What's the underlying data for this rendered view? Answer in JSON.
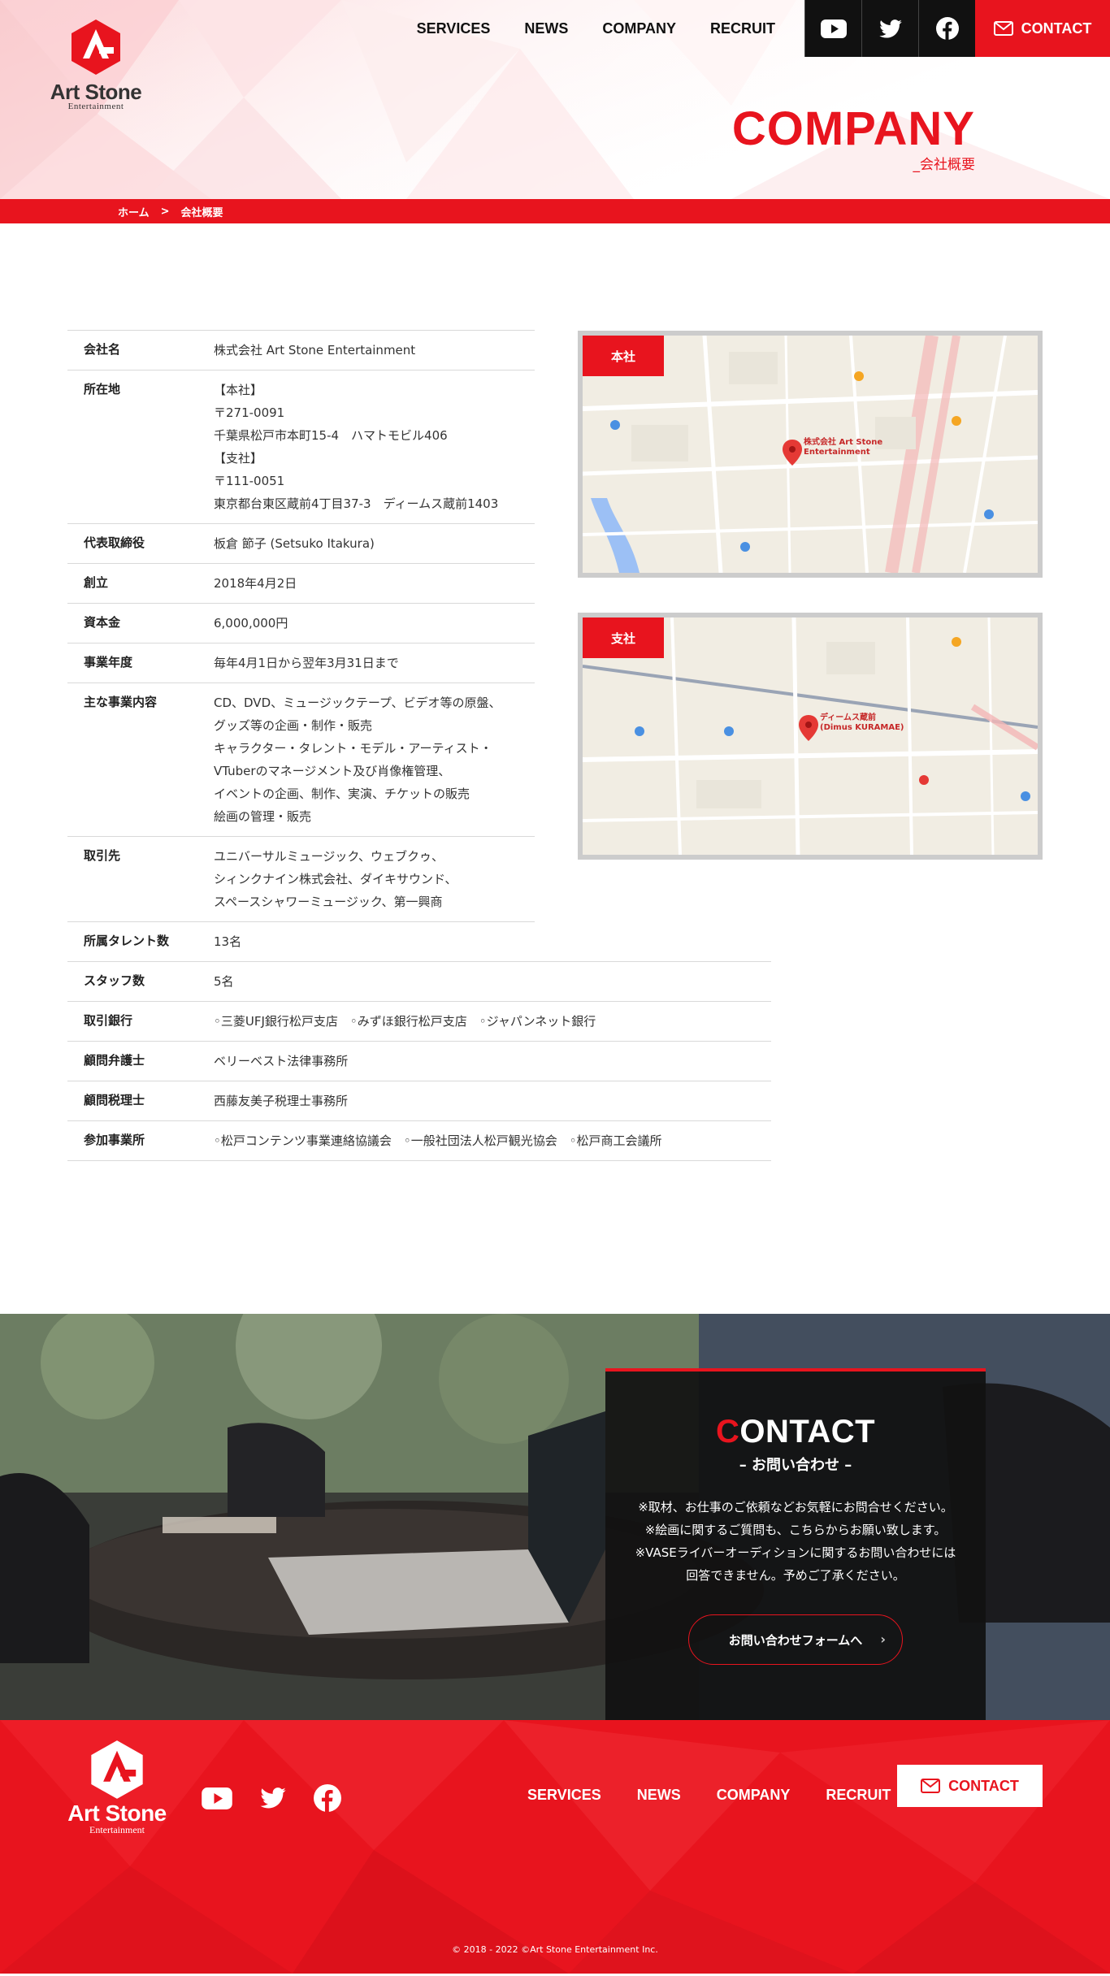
{
  "brand": {
    "name": "Art Stone",
    "sub": "Entertainment"
  },
  "nav": {
    "items": [
      "SERVICES",
      "NEWS",
      "COMPANY",
      "RECRUIT"
    ],
    "contact": "CONTACT",
    "social": [
      "youtube-icon",
      "twitter-icon",
      "facebook-icon"
    ]
  },
  "page": {
    "title_en": "COMPANY",
    "title_jp": "_会社概要"
  },
  "breadcrumb": {
    "home": "ホーム",
    "sep": ">",
    "current": "会社概要"
  },
  "company": {
    "rows": [
      {
        "label": "会社名",
        "lines": [
          "株式会社 Art Stone Entertainment"
        ]
      },
      {
        "label": "所在地",
        "lines": [
          "【本社】",
          "〒271-0091",
          "千葉県松戸市本町15-4　ハマトモビル406",
          "【支社】",
          "〒111-0051",
          "東京都台東区蔵前4丁目37-3　ディームス蔵前1403"
        ]
      },
      {
        "label": "代表取締役",
        "lines": [
          "板倉 節子 (Setsuko Itakura)"
        ]
      },
      {
        "label": "創立",
        "lines": [
          "2018年4月2日"
        ]
      },
      {
        "label": "資本金",
        "lines": [
          "6,000,000円"
        ]
      },
      {
        "label": "事業年度",
        "lines": [
          "毎年4月1日から翌年3月31日まで"
        ]
      },
      {
        "label": "主な事業内容",
        "lines": [
          "CD、DVD、ミュージックテープ、ビデオ等の原盤、",
          "グッズ等の企画・制作・販売",
          "キャラクター・タレント・モデル・アーティスト・",
          "VTuberのマネージメント及び肖像権管理、",
          "イベントの企画、制作、実演、チケットの販売",
          "絵画の管理・販売"
        ]
      },
      {
        "label": "取引先",
        "lines": [
          "ユニバーサルミュージック、ウェブクゥ、",
          "シィンクナイン株式会社、ダイキサウンド、",
          "スペースシャワーミュージック、第一興商"
        ]
      },
      {
        "label": "所属タレント数",
        "lines": [
          "13名"
        ]
      },
      {
        "label": "スタッフ数",
        "lines": [
          "5名"
        ]
      },
      {
        "label": "取引銀行",
        "lines": [
          "◦三菱UFJ銀行松戸支店　◦みずほ銀行松戸支店　◦ジャパンネット銀行"
        ]
      },
      {
        "label": "顧問弁護士",
        "lines": [
          "ベリーベスト法律事務所"
        ]
      },
      {
        "label": "顧問税理士",
        "lines": [
          " 西藤友美子税理士事務所"
        ]
      },
      {
        "label": "参加事業所",
        "lines": [
          "◦松戸コンテンツ事業連絡協議会　◦一般社団法人松戸観光協会　◦松戸商工会議所"
        ]
      }
    ]
  },
  "maps": {
    "hq": {
      "tag": "本社",
      "pin": "株式会社 Art Stone\nEntertainment",
      "pin_lines": [
        "株式会社 Art Stone",
        "Entertainment"
      ]
    },
    "branch": {
      "tag": "支社",
      "pin_lines": [
        "ディームス蔵前",
        "(Dimus KURAMAE)"
      ]
    }
  },
  "contact": {
    "heading_first": "C",
    "heading_rest": "ONTACT",
    "sub": "– お問い合わせ –",
    "notes": [
      "※取材、お仕事のご依頼などお気軽にお問合せください。",
      "※絵画に関するご質問も、こちらからお願い致します。",
      "※VASEライバーオーディションに関するお問い合わせには",
      "回答できません。予めご了承ください。"
    ],
    "button": "お問い合わせフォームへ",
    "arrow": "›"
  },
  "footer": {
    "nav": [
      "SERVICES",
      "NEWS",
      "COMPANY",
      "RECRUIT"
    ],
    "contact": "CONTACT",
    "copyright": "© 2018 - 2022 ©Art Stone Entertainment Inc."
  },
  "colors": {
    "accent": "#e8141e",
    "dark": "#111111"
  }
}
